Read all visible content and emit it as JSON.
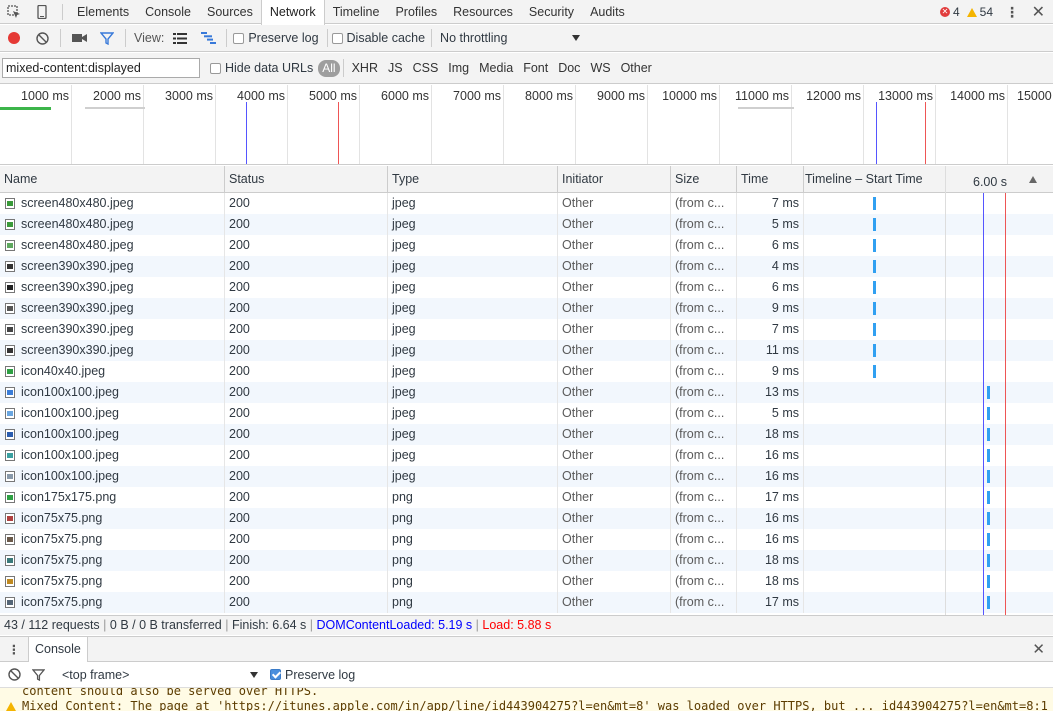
{
  "tabs": [
    "Elements",
    "Console",
    "Sources",
    "Network",
    "Timeline",
    "Profiles",
    "Resources",
    "Security",
    "Audits"
  ],
  "errors": {
    "error_count": "4",
    "warning_count": "54"
  },
  "toolbar": {
    "view_label": "View:",
    "preserve_log": "Preserve log",
    "disable_cache": "Disable cache",
    "throttling": "No throttling"
  },
  "filter": {
    "value": "mixed-content:displayed",
    "hide_data_urls": "Hide data URLs",
    "types": [
      "All",
      "XHR",
      "JS",
      "CSS",
      "Img",
      "Media",
      "Font",
      "Doc",
      "WS",
      "Other"
    ]
  },
  "overview": {
    "ticks": [
      "1000 ms",
      "2000 ms",
      "3000 ms",
      "4000 ms",
      "5000 ms",
      "6000 ms",
      "7000 ms",
      "8000 ms",
      "9000 ms",
      "10000 ms",
      "11000 ms",
      "12000 ms",
      "13000 ms",
      "14000 ms",
      "15000"
    ]
  },
  "grid": {
    "columns": {
      "name": "Name",
      "status": "Status",
      "type": "Type",
      "initiator": "Initiator",
      "size": "Size",
      "time": "Time",
      "timeline": "Timeline – Start Time",
      "timeline_marker": "6.00 s"
    },
    "rows": [
      {
        "name": "screen480x480.jpeg",
        "status": "200",
        "type": "jpeg",
        "initiator": "Other",
        "size": "(from c...",
        "time": "7 ms",
        "icon_color": "#3a9a3a"
      },
      {
        "name": "screen480x480.jpeg",
        "status": "200",
        "type": "jpeg",
        "initiator": "Other",
        "size": "(from c...",
        "time": "5 ms",
        "icon_color": "#3a9a3a"
      },
      {
        "name": "screen480x480.jpeg",
        "status": "200",
        "type": "jpeg",
        "initiator": "Other",
        "size": "(from c...",
        "time": "6 ms",
        "icon_color": "#5fa85f"
      },
      {
        "name": "screen390x390.jpeg",
        "status": "200",
        "type": "jpeg",
        "initiator": "Other",
        "size": "(from c...",
        "time": "4 ms",
        "icon_color": "#333333"
      },
      {
        "name": "screen390x390.jpeg",
        "status": "200",
        "type": "jpeg",
        "initiator": "Other",
        "size": "(from c...",
        "time": "6 ms",
        "icon_color": "#222222"
      },
      {
        "name": "screen390x390.jpeg",
        "status": "200",
        "type": "jpeg",
        "initiator": "Other",
        "size": "(from c...",
        "time": "9 ms",
        "icon_color": "#555555"
      },
      {
        "name": "screen390x390.jpeg",
        "status": "200",
        "type": "jpeg",
        "initiator": "Other",
        "size": "(from c...",
        "time": "7 ms",
        "icon_color": "#444444"
      },
      {
        "name": "screen390x390.jpeg",
        "status": "200",
        "type": "jpeg",
        "initiator": "Other",
        "size": "(from c...",
        "time": "11 ms",
        "icon_color": "#333333"
      },
      {
        "name": "icon40x40.jpeg",
        "status": "200",
        "type": "jpeg",
        "initiator": "Other",
        "size": "(from c...",
        "time": "9 ms",
        "icon_color": "#2ea043"
      },
      {
        "name": "icon100x100.jpeg",
        "status": "200",
        "type": "jpeg",
        "initiator": "Other",
        "size": "(from c...",
        "time": "13 ms",
        "icon_color": "#3b7dd8"
      },
      {
        "name": "icon100x100.jpeg",
        "status": "200",
        "type": "jpeg",
        "initiator": "Other",
        "size": "(from c...",
        "time": "5 ms",
        "icon_color": "#6aa6e0"
      },
      {
        "name": "icon100x100.jpeg",
        "status": "200",
        "type": "jpeg",
        "initiator": "Other",
        "size": "(from c...",
        "time": "18 ms",
        "icon_color": "#2a5db0"
      },
      {
        "name": "icon100x100.jpeg",
        "status": "200",
        "type": "jpeg",
        "initiator": "Other",
        "size": "(from c...",
        "time": "16 ms",
        "icon_color": "#3aa0a0"
      },
      {
        "name": "icon100x100.jpeg",
        "status": "200",
        "type": "jpeg",
        "initiator": "Other",
        "size": "(from c...",
        "time": "16 ms",
        "icon_color": "#8899aa"
      },
      {
        "name": "icon175x175.png",
        "status": "200",
        "type": "png",
        "initiator": "Other",
        "size": "(from c...",
        "time": "17 ms",
        "icon_color": "#2ea043"
      },
      {
        "name": "icon75x75.png",
        "status": "200",
        "type": "png",
        "initiator": "Other",
        "size": "(from c...",
        "time": "16 ms",
        "icon_color": "#b04040"
      },
      {
        "name": "icon75x75.png",
        "status": "200",
        "type": "png",
        "initiator": "Other",
        "size": "(from c...",
        "time": "16 ms",
        "icon_color": "#6b5a4a"
      },
      {
        "name": "icon75x75.png",
        "status": "200",
        "type": "png",
        "initiator": "Other",
        "size": "(from c...",
        "time": "18 ms",
        "icon_color": "#3a7a7a"
      },
      {
        "name": "icon75x75.png",
        "status": "200",
        "type": "png",
        "initiator": "Other",
        "size": "(from c...",
        "time": "18 ms",
        "icon_color": "#c08a20"
      },
      {
        "name": "icon75x75.png",
        "status": "200",
        "type": "png",
        "initiator": "Other",
        "size": "(from c...",
        "time": "17 ms",
        "icon_color": "#556677"
      }
    ]
  },
  "status": {
    "requests": "43 / 112 requests",
    "transferred": "0 B / 0 B transferred",
    "finish": "Finish: 6.64 s",
    "dcl": "DOMContentLoaded: 5.19 s",
    "load": "Load: 5.88 s",
    "dcl_color": "#0000ff",
    "load_color": "#ff0000"
  },
  "drawer": {
    "tab": "Console",
    "context": "<top frame>",
    "preserve_log": "Preserve log",
    "messages": [
      "content should also be served over HTTPS.",
      "Mixed Content: The page at 'https://itunes.apple.com/in/app/line/id443904275?l=en&mt=8' was loaded over HTTPS, but ... id443904275?l=en&mt=8:1"
    ]
  },
  "colors": {
    "bar": "#31a0f1",
    "accent": "#3879d9",
    "record": "#e53935"
  }
}
